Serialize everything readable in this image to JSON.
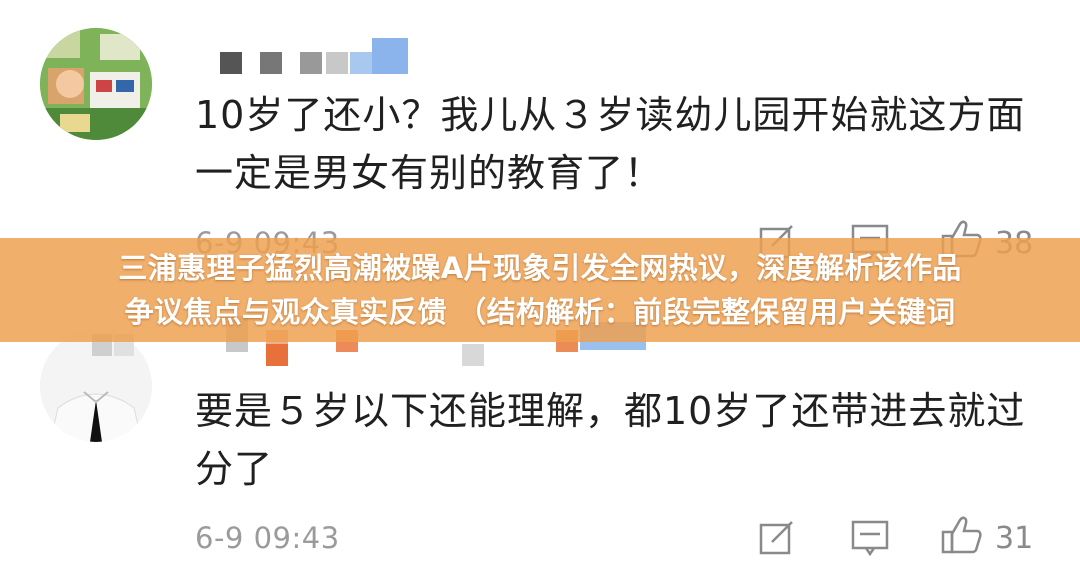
{
  "comments": [
    {
      "text": "10岁了还小？我儿从３岁读幼儿园开始就这方面一定是男女有别的教育了！",
      "timestamp": "6-9 09:43",
      "likes": "38",
      "icons": [
        "edit-icon",
        "reply-icon",
        "thumbs-up-icon"
      ]
    },
    {
      "text": "要是５岁以下还能理解，都10岁了还带进去就过分了",
      "timestamp": "6-9 09:43",
      "likes": "31",
      "icons": [
        "edit-icon",
        "reply-icon",
        "thumbs-up-icon"
      ]
    }
  ],
  "banner": {
    "line1": "三浦惠理子猛烈高潮被躁A片现象引发全网热议，深度解析该作品",
    "line2": "争议焦点与观众真实反馈 （结构解析：前段完整保留用户关键词"
  },
  "colors": {
    "banner_bg": "#EEA050",
    "text": "#202020",
    "meta": "#9B9B9B"
  }
}
